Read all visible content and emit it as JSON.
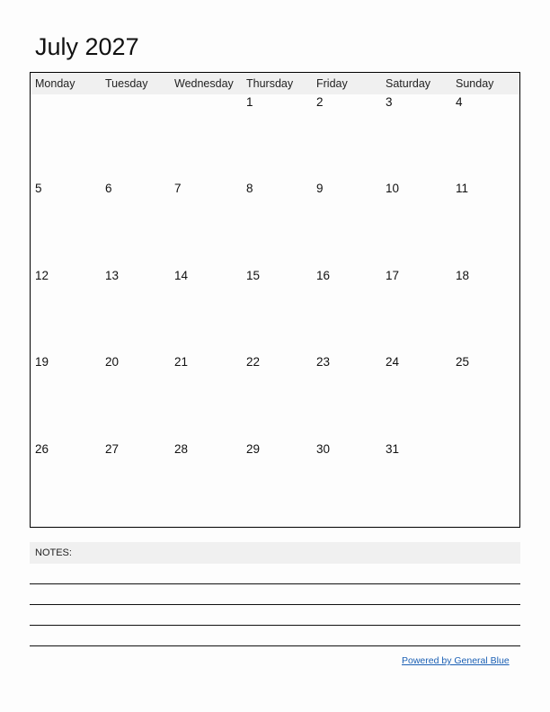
{
  "title": "July 2027",
  "weekdays": [
    "Monday",
    "Tuesday",
    "Wednesday",
    "Thursday",
    "Friday",
    "Saturday",
    "Sunday"
  ],
  "weeks": [
    [
      "",
      "",
      "",
      "1",
      "2",
      "3",
      "4"
    ],
    [
      "5",
      "6",
      "7",
      "8",
      "9",
      "10",
      "11"
    ],
    [
      "12",
      "13",
      "14",
      "15",
      "16",
      "17",
      "18"
    ],
    [
      "19",
      "20",
      "21",
      "22",
      "23",
      "24",
      "25"
    ],
    [
      "26",
      "27",
      "28",
      "29",
      "30",
      "31",
      ""
    ]
  ],
  "notes": {
    "label": "NOTES:",
    "line_count": 4
  },
  "footer": {
    "link_text": "Powered by General Blue",
    "link_color": "#1a5fb4"
  }
}
